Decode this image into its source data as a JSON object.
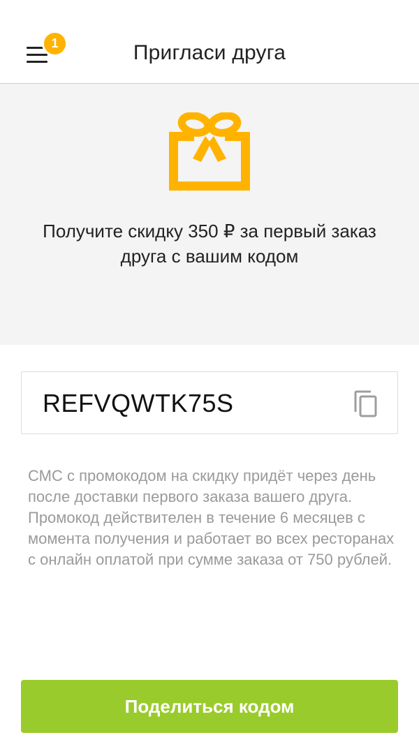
{
  "colors": {
    "accent": "#FFB300",
    "primary_button": "#9ACB2C",
    "hero_background": "#f4f4f4",
    "info_text": "#9a9a9a"
  },
  "header": {
    "title": "Пригласи друга",
    "menu_icon": "hamburger-menu-icon",
    "notification_count": "1"
  },
  "hero": {
    "icon": "gift-icon",
    "text": "Получите скидку 350 ₽ за первый заказ друга с вашим кодом"
  },
  "referral": {
    "code": "REFVQWTK75S",
    "copy_icon": "copy-icon"
  },
  "info": {
    "text": "СМС с промокодом на скидку придёт через день после доставки первого заказа вашего друга. Промокод действителен в течение 6 месяцев с момента получения и работает во всех ресторанах с онлайн оплатой при сумме заказа от 750 рублей."
  },
  "actions": {
    "share_label": "Поделиться кодом"
  }
}
